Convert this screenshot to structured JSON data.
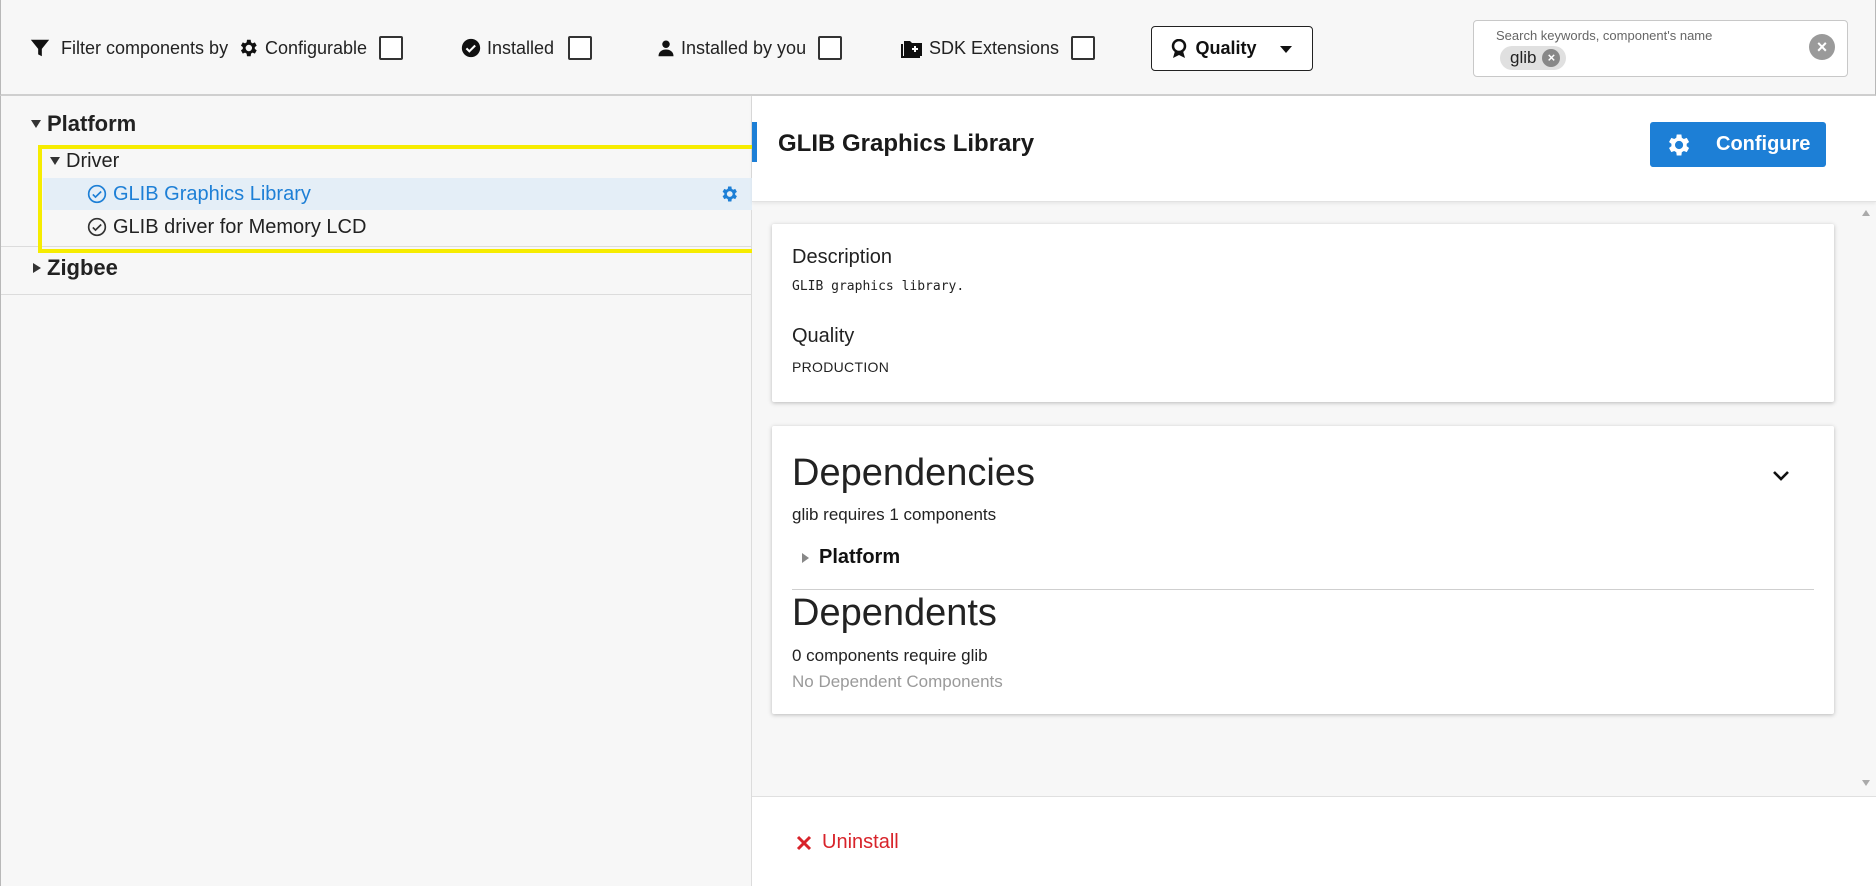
{
  "filters": {
    "label": "Filter components by",
    "configurable": "Configurable",
    "installed": "Installed",
    "installed_by_you": "Installed by you",
    "sdk_extensions": "SDK Extensions",
    "quality_button": "Quality"
  },
  "search": {
    "label": "Search keywords, component's name",
    "chip": "glib"
  },
  "tree": {
    "categories": [
      {
        "label": "Platform",
        "expanded": true,
        "subcategories": [
          {
            "label": "Driver",
            "expanded": true,
            "items": [
              {
                "label": "GLIB Graphics Library",
                "selected": true,
                "configurable": true
              },
              {
                "label": "GLIB driver for Memory LCD",
                "selected": false,
                "configurable": false
              }
            ]
          }
        ]
      },
      {
        "label": "Zigbee",
        "expanded": false
      }
    ]
  },
  "detail": {
    "title": "GLIB Graphics Library",
    "configure_label": "Configure",
    "description_label": "Description",
    "description_value": "GLIB graphics library.",
    "quality_label": "Quality",
    "quality_value": "PRODUCTION",
    "dependencies_heading": "Dependencies",
    "dependencies_summary": "glib requires 1 components",
    "dependencies_group": "Platform",
    "dependents_heading": "Dependents",
    "dependents_summary": "0 components require glib",
    "dependents_empty": "No Dependent Components",
    "uninstall_label": "Uninstall"
  },
  "colors": {
    "accent": "#1d7fd6",
    "highlight": "#f6ec00",
    "danger": "#d8232a",
    "selected_row_bg": "#e4eef7"
  }
}
